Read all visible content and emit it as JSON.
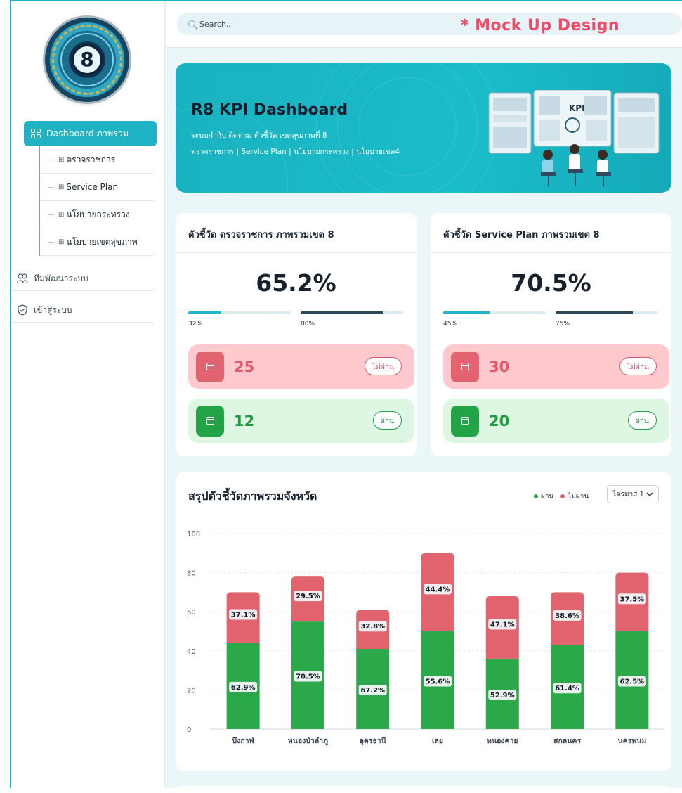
{
  "sidebar": {
    "main_item": "Dashboard ภาพรวม",
    "sub_items": [
      "ตรวจราชการ",
      "Service Plan",
      "นโยบายกระทรวง",
      "นโยบายเขตสุขภาพ"
    ],
    "items": [
      "ทีมพัฒนาระบบ",
      "เข้าสู่ระบบ"
    ],
    "logo_text": "8"
  },
  "topbar": {
    "search_placeholder": "Search...",
    "mock_label": "* Mock Up Design"
  },
  "hero": {
    "title": "R8 KPI Dashboard",
    "subtitle": "ระบบกำกับ ติดตาม ตัวชี้วัด เขตสุขภาพที่ 8",
    "subtitle2": "ตรวจราชการ | Service Plan | นโยบายกระทรวง | นโยบายเขต4",
    "illustration_label": "KPI"
  },
  "kpi_cards": [
    {
      "title": "ตัวชี้วัด ตรวจราชการ ภาพรวมเขต 8",
      "percent": "65.2%",
      "bar1_value": 32,
      "bar1_label": "32%",
      "bar2_value": 80,
      "bar2_label": "80%",
      "fail_count": "25",
      "fail_label": "ไม่ผ่าน",
      "pass_count": "12",
      "pass_label": "ผ่าน"
    },
    {
      "title": "ตัวชี้วัด Service Plan ภาพรวมเขต 8",
      "percent": "70.5%",
      "bar1_value": 45,
      "bar1_label": "45%",
      "bar2_value": 75,
      "bar2_label": "75%",
      "fail_count": "30",
      "fail_label": "ไม่ผ่าน",
      "pass_count": "20",
      "pass_label": "ผ่าน"
    }
  ],
  "chart": {
    "title": "สรุปตัวชี้วัดภาพรวมจังหวัด",
    "legend_pass": "ผ่าน",
    "legend_fail": "ไม่ผ่าน",
    "select_value": "ไตรมาส 1"
  },
  "colors": {
    "accent": "#1fb3c3",
    "pass": "#2aa84a",
    "fail": "#e0636e",
    "mock_label": "#ef4a67"
  },
  "chart_data": {
    "type": "bar",
    "stacked": true,
    "categories": [
      "บึงกาฬ",
      "หนองบัวลำภู",
      "อุดรธานี",
      "เลย",
      "หนองคาย",
      "สกลนคร",
      "นครพนม"
    ],
    "series": [
      {
        "name": "ผ่าน",
        "values": [
          44,
          55,
          41,
          50,
          36,
          43,
          50
        ],
        "labels": [
          "62.9%",
          "70.5%",
          "67.2%",
          "55.6%",
          "52.9%",
          "61.4%",
          "62.5%"
        ]
      },
      {
        "name": "ไม่ผ่าน",
        "values": [
          26,
          23,
          20,
          40,
          32,
          27,
          30
        ],
        "labels": [
          "37.1%",
          "29.5%",
          "32.8%",
          "44.4%",
          "47.1%",
          "38.6%",
          "37.5%"
        ]
      }
    ],
    "y_ticks": [
      "0",
      "20",
      "40",
      "60",
      "80",
      "100"
    ],
    "ylim": [
      0,
      100
    ],
    "grid": true,
    "legend_position": "top-right"
  }
}
